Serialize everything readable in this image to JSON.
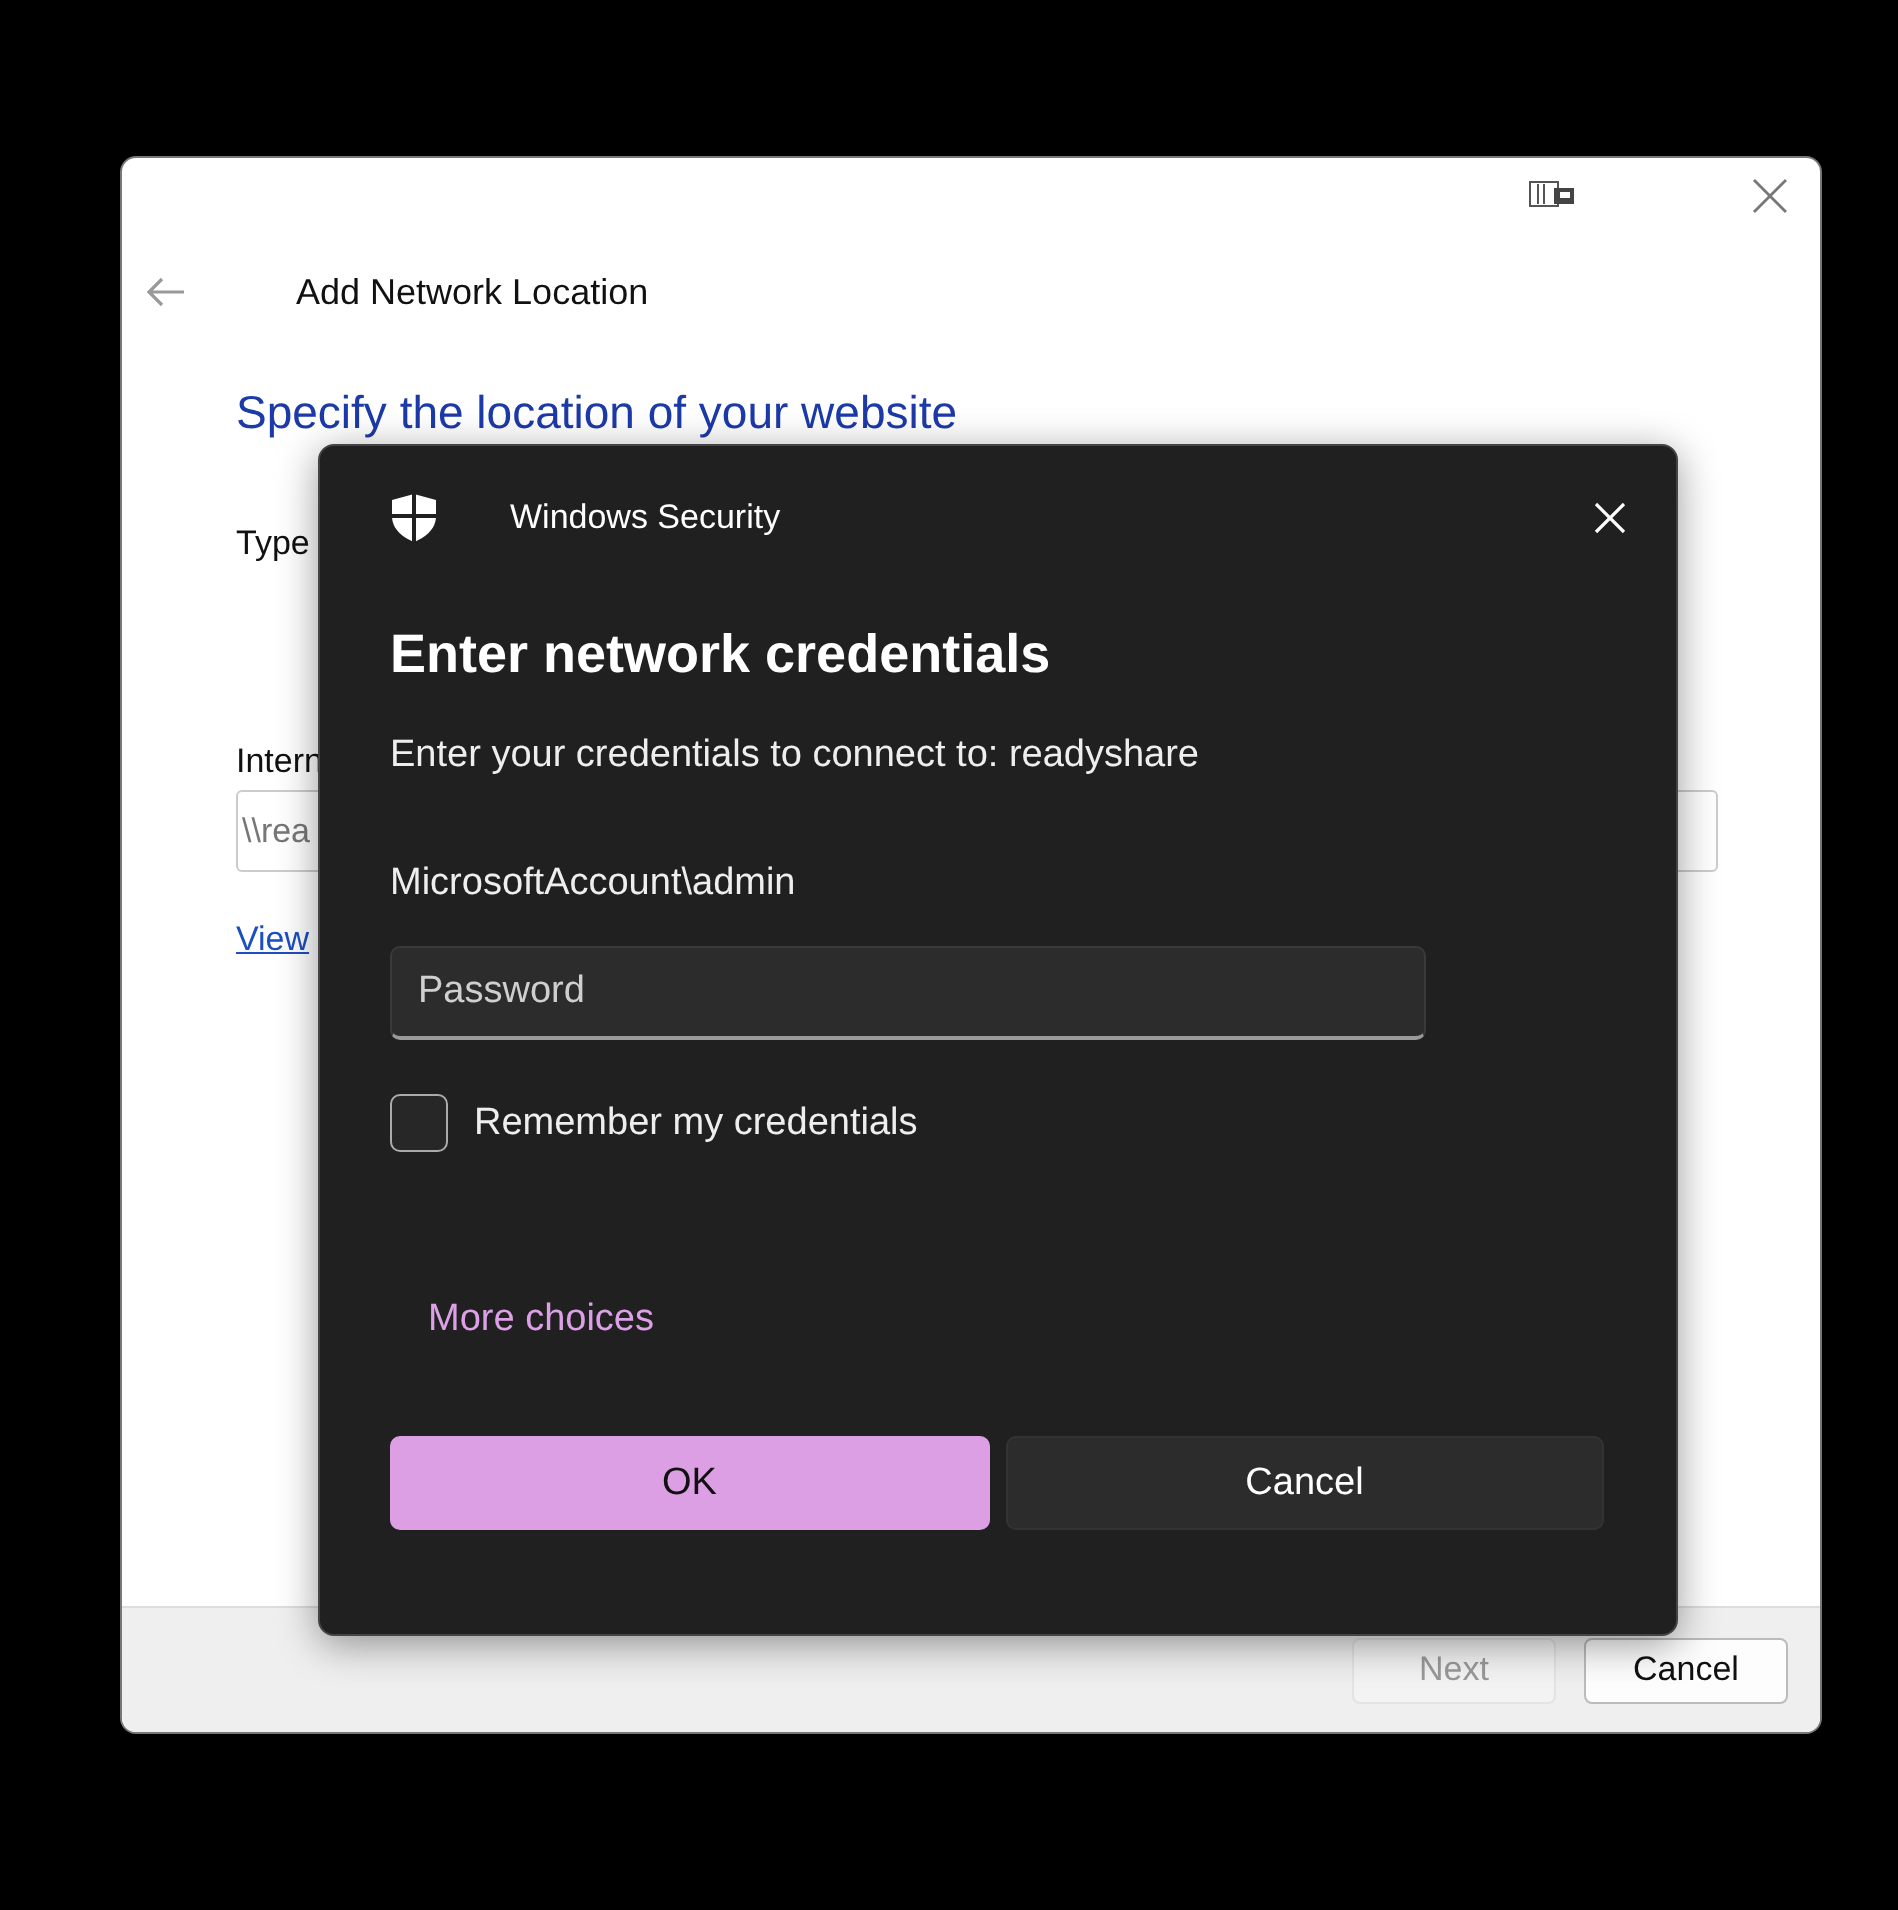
{
  "window": {
    "title": "Add Network Location",
    "heading": "Specify the location of your website",
    "prompt": "Type",
    "field_label": "Intern",
    "address_field": {
      "value": "\\\\rea"
    },
    "link": "View",
    "buttons": [
      {
        "label": "Next",
        "disabled": true
      },
      {
        "label": "Cancel",
        "disabled": false
      }
    ]
  },
  "dialog": {
    "app_title": "Windows Security",
    "title": "Enter network credentials",
    "message": "Enter your credentials to connect to: readyshare",
    "user": "MicrosoftAccount\\admin",
    "password": {
      "placeholder": "Password"
    },
    "remember": {
      "label": "Remember my credentials",
      "checked": false
    },
    "more_choices": "More choices",
    "buttons": [
      {
        "label": "OK",
        "kind": "primary"
      },
      {
        "label": "Cancel",
        "kind": "secondary"
      }
    ]
  }
}
